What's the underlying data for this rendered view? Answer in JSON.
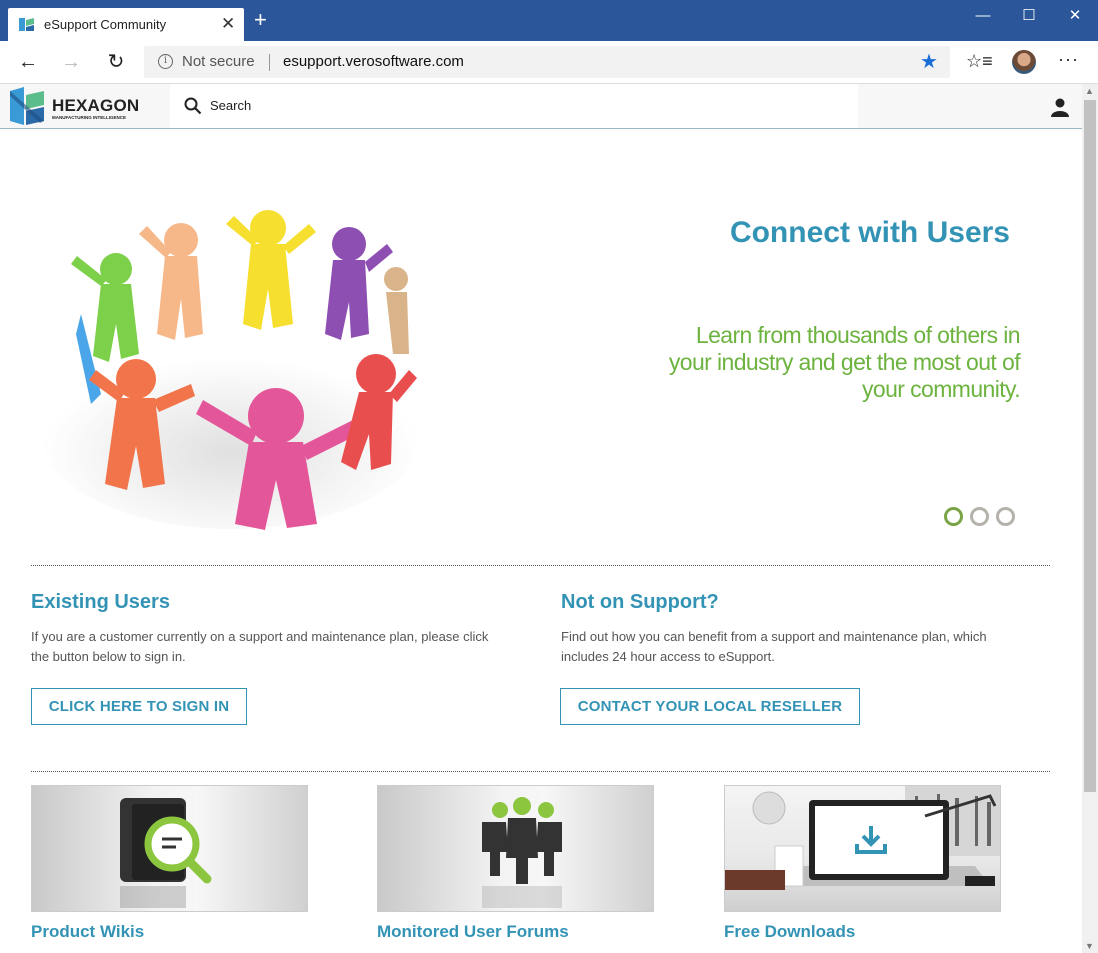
{
  "browser": {
    "tab_title": "eSupport Community",
    "new_tab": "+",
    "close": "✕",
    "minimize": "—",
    "maximize": "☐",
    "window_close": "✕",
    "security_label": "Not secure",
    "url": "esupport.verosoftware.com",
    "back": "←",
    "forward": "→",
    "refresh": "↻",
    "menu": "···"
  },
  "header": {
    "logo_text": "HEXAGON",
    "logo_subtext": "MANUFACTURING INTELLIGENCE",
    "search_label": "Search"
  },
  "hero": {
    "title": "Connect with Users",
    "text": "Learn from thousands of others in your industry and get the most out of your community.",
    "slide_count": 3,
    "active_slide": 1
  },
  "existing_users": {
    "title": "Existing Users",
    "text": "If you are a customer currently on a support and maintenance plan, please click the button below to sign in.",
    "button": "CLICK HERE TO SIGN IN"
  },
  "not_on_support": {
    "title": "Not on Support?",
    "text": "Find out how you can benefit from a support and maintenance plan, which includes 24 hour access to eSupport.",
    "button": "CONTACT YOUR LOCAL RESELLER"
  },
  "cards": [
    {
      "label": "Product Wikis"
    },
    {
      "label": "Monitored User Forums"
    },
    {
      "label": "Free Downloads"
    }
  ],
  "colors": {
    "accent": "#3393b5",
    "green": "#6db33f",
    "titlebar": "#2b579a"
  }
}
